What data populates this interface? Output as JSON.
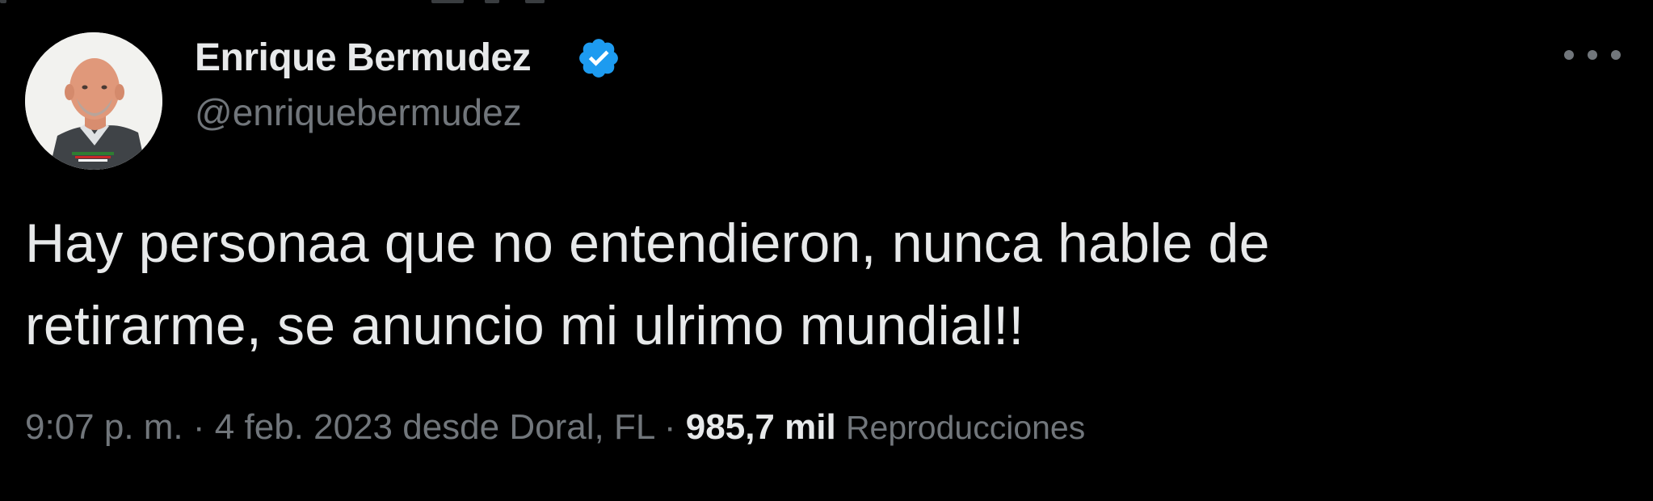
{
  "author": {
    "name": "Enrique Bermudez",
    "handle": "@enriquebermudez",
    "verified": true
  },
  "tweet": {
    "text": "Hay personaa que no entendieron, nunca hable de\nretirarme, se anuncio mi ulrimo mundial!!"
  },
  "meta": {
    "time": "9:07 p. m.",
    "separator": "·",
    "date": "4 feb. 2023",
    "location_prefix": "desde",
    "location": "Doral, FL",
    "views_count": "985,7 mil",
    "views_label": "Reproducciones"
  },
  "icons": {
    "verified": "verified-badge-icon",
    "more": "more-options-icon"
  },
  "colors": {
    "background": "#000000",
    "primary_text": "#e7e9ea",
    "secondary_text": "#71767b",
    "verified_blue": "#1d9bf0"
  }
}
